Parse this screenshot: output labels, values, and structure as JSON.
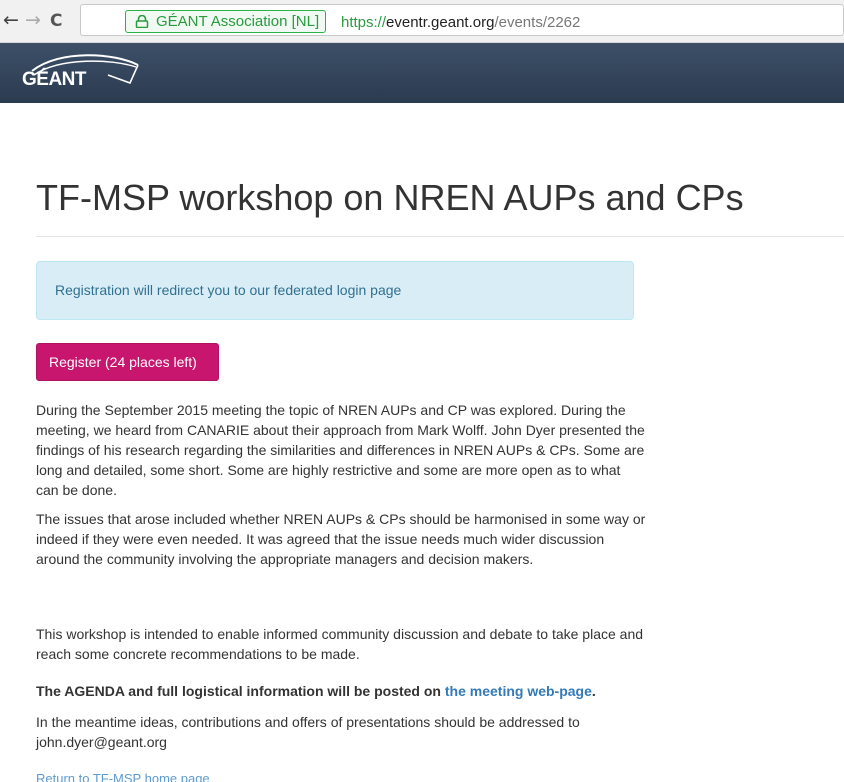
{
  "browser": {
    "back_icon": "←",
    "forward_icon": "→",
    "reload_icon": "C",
    "ev_label": "GÉANT Association [NL]",
    "url_scheme": "https://",
    "url_host": "eventr.geant.org",
    "url_path": "/events/2262"
  },
  "header": {
    "logo_text": "GÉANT",
    "color": "#34455b"
  },
  "page": {
    "title": "TF-MSP workshop on NREN AUPs and CPs",
    "alert": "Registration will redirect you to our federated login page",
    "register_button": "Register (24 places left)",
    "paragraphs": [
      "During the September 2015 meeting the topic of NREN AUPs and CP was explored. During the meeting, we heard from CANARIE about their approach from Mark Wolff. John Dyer presented the findings of his research regarding the similarities and differences in NREN AUPs & CPs. Some are long and detailed, some short. Some are highly restrictive and some are more open as to what can be done.",
      "The issues that arose included whether NREN AUPs & CPs should be harmonised in some way or indeed if they were even needed. It was agreed that the issue needs much wider discussion around the community involving the appropriate managers and decision makers.",
      "This workshop is intended to enable informed community discussion and debate to take place and reach some concrete recommendations to be made."
    ],
    "agenda_text": "The AGENDA and full logistical information will be posted on ",
    "agenda_link": "the meeting web-page",
    "agenda_end": ".",
    "contact_text": "In the meantime ideas, contributions and offers of presentations should be addressed to john.dyer@geant.org",
    "return_link": "Return to TF-MSP home page"
  },
  "colors": {
    "register": "#c8156e",
    "alert_bg": "#d9edf7",
    "alert_text": "#31708f",
    "link": "#337ab7",
    "ev_green": "#2a9a3f"
  }
}
